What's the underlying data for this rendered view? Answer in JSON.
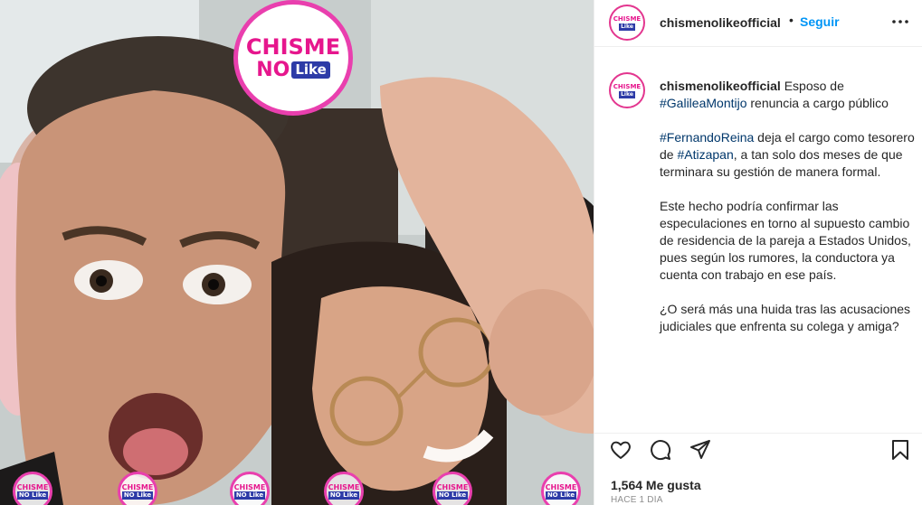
{
  "post": {
    "media": {
      "description_alt": "",
      "brand_logo": {
        "line1": "CHISME",
        "line2_no": "NO",
        "line2_like": "Like"
      },
      "watermark": {
        "line1": "CHISME",
        "line2": "NO Like"
      }
    },
    "header": {
      "username": "chismenolikeofficial",
      "separator": "•",
      "follow_label": "Seguir",
      "more_icon": "more-horizontal-icon"
    },
    "caption": {
      "username": "chismenolikeofficial",
      "intro": " Esposo de ",
      "tag_galilea": "#GalileaMontijo",
      "intro_rest": " renuncia a cargo público",
      "tag_fernando": "#FernandoReina",
      "p2_a": " deja el cargo como tesorero de ",
      "tag_atizapan": "#Atizapan",
      "p2_b": ", a tan solo dos meses de que terminara su gestión de manera formal.",
      "p3": "Este hecho podría confirmar las especulaciones en torno al supuesto cambio de residencia de la pareja a Estados Unidos, pues según los rumores, la conductora ya cuenta con trabajo en ese país.",
      "p4": "¿O será más una huida tras las acusaciones judiciales que enfrenta su colega y amiga?"
    },
    "actions": {
      "icons": [
        "heart-icon",
        "comment-icon",
        "share-icon",
        "bookmark-icon"
      ],
      "likes_text": "1,564 Me gusta",
      "time_text": "HACE 1 DÍA"
    },
    "colors": {
      "link_blue": "#0095f6",
      "hashtag": "#00376b",
      "brand_pink": "#e6168d",
      "brand_blue": "#2d3ba7"
    }
  }
}
